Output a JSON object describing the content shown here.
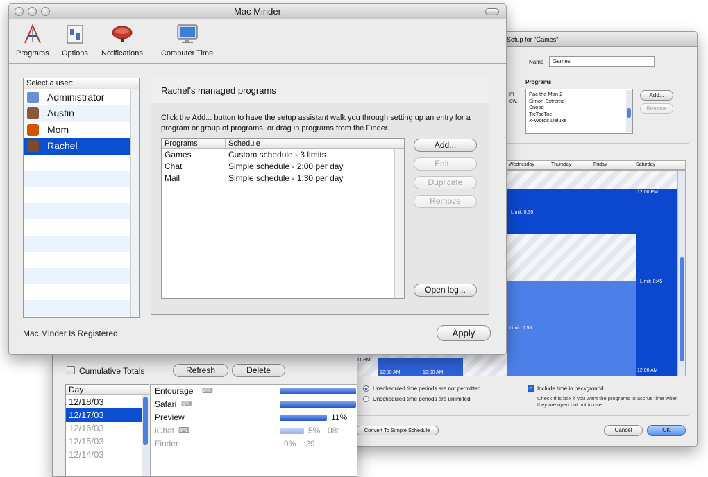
{
  "setup_window": {
    "title": "Setup for \"Games\"",
    "name_label": "Name",
    "name_value": "Games",
    "programs_label": "Programs",
    "programs": [
      "Pac the Man 2",
      "Simon Extreme",
      "Snood",
      "TicTacToe",
      "X-Words Deluxe"
    ],
    "side_text_1": "m",
    "side_text_2": "ow,",
    "add_button": "Add...",
    "remove_button": "Remove",
    "days": [
      "Wednesday",
      "Thursday",
      "Friday",
      "Saturday"
    ],
    "label_noon_1": "12:00 PM",
    "label_limit_030": "Limit: 0:30",
    "label_limit_045": "Limit: 0:45",
    "label_limit_050": "Limit: 0:50",
    "label_am_1": "12:00 AM",
    "label_am_2": "12:00 AM",
    "label_am_3": "12:00 AM",
    "label_11pm": "11 PM",
    "radio_not_permitted": "Unscheduled time periods are not permitted",
    "radio_unlimited": "Unscheduled time periods are unlimited",
    "include_background_label": "Include time in background",
    "include_background_help": "Check this box if you want the programs to accrue time when they are open but not in use.",
    "convert_button": "Convert To Simple Schedule",
    "cancel_button": "Cancel",
    "ok_button": "OK"
  },
  "stats_window": {
    "cumulative_label": "Cumulative Totals",
    "refresh_button": "Refresh",
    "delete_button": "Delete",
    "day_header": "Day",
    "days": [
      "12/18/03",
      "12/17/03",
      "12/16/03",
      "12/15/03",
      "12/14/03"
    ],
    "apps": [
      {
        "name": "Entourage",
        "bar": 1.0,
        "pct": "",
        "time": ""
      },
      {
        "name": "Safari",
        "bar": 1.0,
        "pct": "",
        "time": ""
      },
      {
        "name": "Preview",
        "bar": 0.62,
        "pct": "11%",
        "time": ""
      },
      {
        "name": "iChat",
        "bar": 0.32,
        "pct": "5%",
        "time": "08:"
      },
      {
        "name": "Finder",
        "bar": 0.0,
        "pct": "0%",
        "time": ":29"
      }
    ]
  },
  "main_window": {
    "title": "Mac Minder",
    "toolbar": [
      "Programs",
      "Options",
      "Notifications",
      "Computer Time"
    ],
    "select_user_label": "Select a user:",
    "users": [
      "Administrator",
      "Austin",
      "Mom",
      "Rachel"
    ],
    "panel_title": "Rachel's managed programs",
    "instructions": "Click the Add... button to have the setup assistant walk you through setting up an entry for a program or group of programs, or drag in programs from the Finder.",
    "columns": [
      "Programs",
      "Schedule"
    ],
    "rows": [
      {
        "program": "Games",
        "schedule": "Custom schedule - 3 limits"
      },
      {
        "program": "Chat",
        "schedule": "Simple schedule - 2:00 per day"
      },
      {
        "program": "Mail",
        "schedule": "Simple schedule - 1:30 per day"
      }
    ],
    "add_button": "Add...",
    "edit_button": "Edit...",
    "duplicate_button": "Duplicate",
    "remove_button": "Remove",
    "open_log_button": "Open log...",
    "status": "Mac Minder Is Registered",
    "apply_button": "Apply"
  },
  "colors": {
    "selection": "#0b4fd1",
    "schedule_dark": "#0b47cf",
    "schedule_light": "#4d7fe8"
  }
}
